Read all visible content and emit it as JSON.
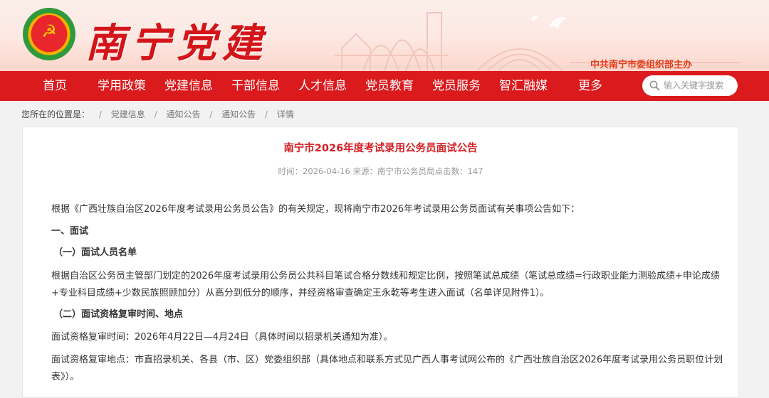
{
  "header": {
    "logo_glyph": "☭",
    "site_title": "南宁党建",
    "sponsor": "中共南宁市委组织部主办"
  },
  "nav": {
    "items": [
      "首页",
      "学用政策",
      "党建信息",
      "干部信息",
      "人才信息",
      "党员教育",
      "党员服务",
      "智汇融媒",
      "更多"
    ],
    "search_placeholder": "输入关键字搜索"
  },
  "breadcrumb": {
    "label": "您所在的位置是：",
    "items": [
      "党建信息",
      "通知公告",
      "通知公告"
    ],
    "current": "详情"
  },
  "article": {
    "title": "南宁市2026年度考试录用公务员面试公告",
    "meta": "时间：2026-04-16 来源：南宁市公务员局点击数：147",
    "paragraphs": [
      "根据《广西壮族自治区2026年度考试录用公务员公告》的有关规定，现将南宁市2026年考试录用公务员面试有关事项公告如下：",
      "一、面试",
      "（一）面试人员名单",
      "根据自治区公务员主管部门划定的2026年度考试录用公务员公共科目笔试合格分数线和规定比例，按照笔试总成绩（笔试总成绩=行政职业能力测验成绩+申论成绩+专业科目成绩+少数民族照顾加分）从高分到低分的顺序，并经资格审查确定王永乾等考生进入面试（名单详见附件1）。",
      "（二）面试资格复审时间、地点",
      "面试资格复审时间：2026年4月22日—4月24日（具体时间以招录机关通知为准）。",
      "面试资格复审地点：市直招录机关、各县（市、区）党委组织部（具体地点和联系方式见广西人事考试网公布的《广西壮族自治区2026年度考试录用公务员职位计划表》）。"
    ]
  },
  "colors": {
    "nav_red": "#db1a1e",
    "title_red": "#d51f24",
    "sponsor_orange": "#e23d1a"
  }
}
